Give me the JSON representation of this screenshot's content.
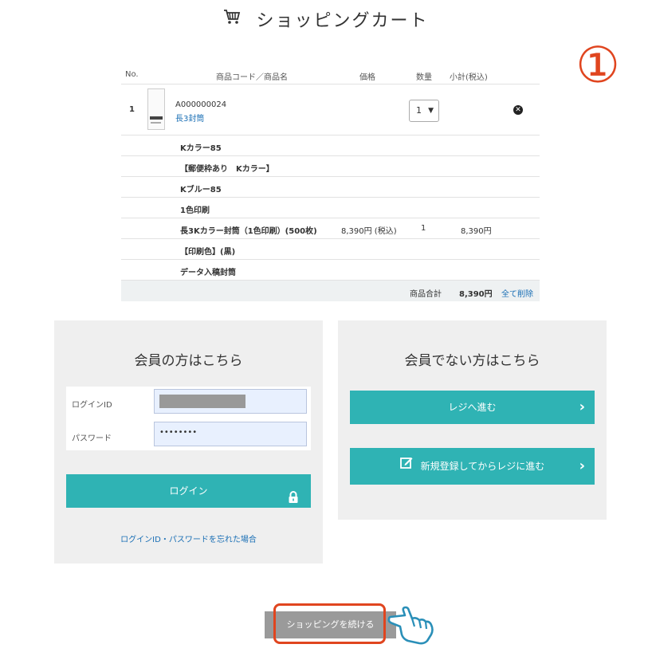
{
  "page": {
    "title": "ショッピングカート",
    "step_marker": "①"
  },
  "cart": {
    "headers": {
      "no": "No.",
      "product": "商品コード／商品名",
      "price": "価格",
      "qty": "数量",
      "subtotal": "小計(税込)"
    },
    "item": {
      "no": "1",
      "code": "A000000024",
      "name": "長3封筒",
      "qty_selected": "1"
    },
    "options": [
      {
        "label": "Kカラー85",
        "price": "",
        "qty": "",
        "subtotal": ""
      },
      {
        "label": "【郵便枠あり　Kカラー】",
        "price": "",
        "qty": "",
        "subtotal": ""
      },
      {
        "label": "Kブルー85",
        "price": "",
        "qty": "",
        "subtotal": ""
      },
      {
        "label": "1色印刷",
        "price": "",
        "qty": "",
        "subtotal": ""
      },
      {
        "label": "長3Kカラー封筒（1色印刷）(500枚)",
        "price": "8,390円 (税込)",
        "qty": "1",
        "subtotal": "8,390円"
      },
      {
        "label": "【印刷色】(黒)",
        "price": "",
        "qty": "",
        "subtotal": ""
      },
      {
        "label": "データ入稿封筒",
        "price": "",
        "qty": "",
        "subtotal": ""
      }
    ],
    "total": {
      "label": "商品合計",
      "value": "8,390円",
      "delete_all": "全て削除"
    }
  },
  "member": {
    "title": "会員の方はこちら",
    "login_id_label": "ログインID",
    "password_label": "パスワード",
    "password_value": "••••••••",
    "login_button": "ログイン",
    "forgot_link": "ログインID・パスワードを忘れた場合"
  },
  "guest": {
    "title": "会員でない方はこちら",
    "register_button": "レジへ進む",
    "new_register_button": "新規登録してからレジに進む"
  },
  "footer": {
    "continue_button": "ショッピングを続ける"
  },
  "colors": {
    "accent": "#2fb3b4",
    "link": "#1a6fb5",
    "highlight": "#e0451f"
  }
}
